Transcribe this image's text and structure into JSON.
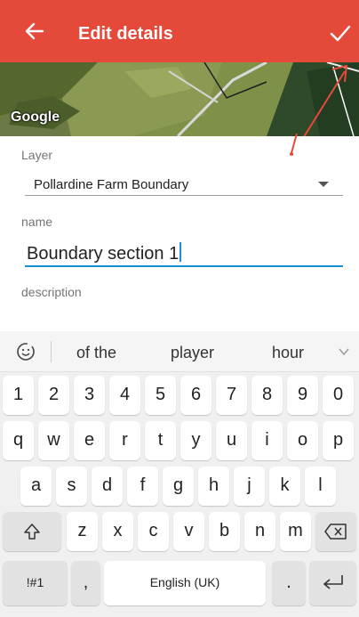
{
  "appbar": {
    "title": "Edit details",
    "back_icon": "arrow-left-icon",
    "confirm_icon": "checkmark-icon",
    "color": "#e5493a"
  },
  "map": {
    "attribution": "Google"
  },
  "form": {
    "layer_label": "Layer",
    "layer_value": "Pollardine Farm Boundary",
    "name_label": "name",
    "name_value": "Boundary section 1",
    "description_label": "description",
    "accent_color": "#1a8fd6"
  },
  "keyboard": {
    "suggestions": [
      "of the",
      "player",
      "hour"
    ],
    "number_row": [
      "1",
      "2",
      "3",
      "4",
      "5",
      "6",
      "7",
      "8",
      "9",
      "0"
    ],
    "row1": [
      "q",
      "w",
      "e",
      "r",
      "t",
      "y",
      "u",
      "i",
      "o",
      "p"
    ],
    "row2": [
      "a",
      "s",
      "d",
      "f",
      "g",
      "h",
      "j",
      "k",
      "l"
    ],
    "row3": [
      "z",
      "x",
      "c",
      "v",
      "b",
      "n",
      "m"
    ],
    "symbols_label": "!#1",
    "comma_label": ",",
    "space_label": "English (UK)",
    "period_label": "."
  }
}
